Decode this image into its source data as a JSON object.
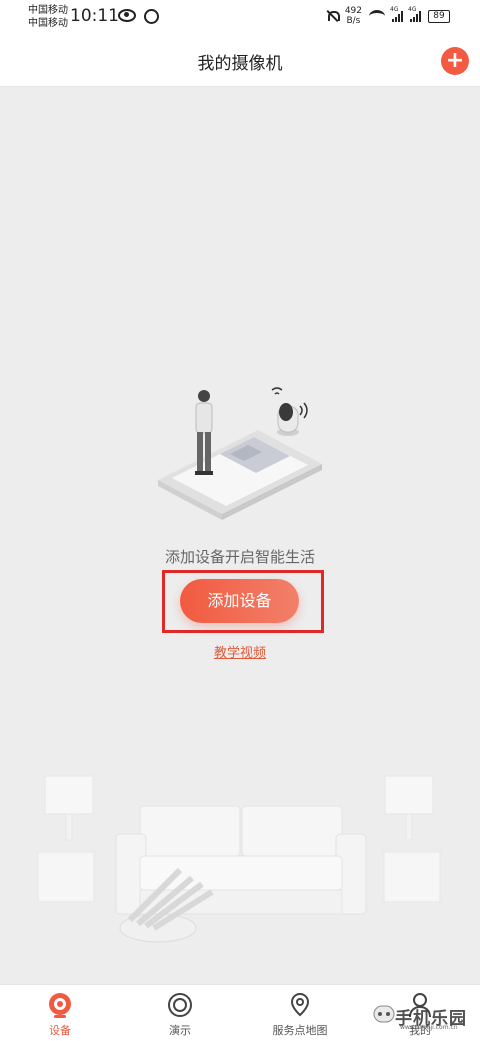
{
  "status_bar": {
    "carrier_1": "中国移动",
    "carrier_2": "中国移动",
    "time": "10:11",
    "net_speed_value": "492",
    "net_speed_unit": "B/s",
    "signal_1_label": "4G",
    "signal_2_label": "4G",
    "battery": "89"
  },
  "header": {
    "title": "我的摄像机",
    "add_icon": "plus-icon"
  },
  "empty_state": {
    "prompt": "添加设备开启智能生活",
    "add_device_button": "添加设备",
    "tutorial_link": "教学视频"
  },
  "tabbar": {
    "items": [
      {
        "label": "设备",
        "icon": "camera-icon",
        "active": true
      },
      {
        "label": "演示",
        "icon": "lens-icon",
        "active": false
      },
      {
        "label": "服务点地图",
        "icon": "map-pin-icon",
        "active": false
      },
      {
        "label": "我的",
        "icon": "person-icon",
        "active": false
      }
    ]
  },
  "watermark": {
    "text": "手机乐园",
    "subtext": "www.shouji.com.cn"
  },
  "colors": {
    "accent": "#f15a40",
    "background": "#ededee",
    "highlight_box": "#e02828"
  }
}
